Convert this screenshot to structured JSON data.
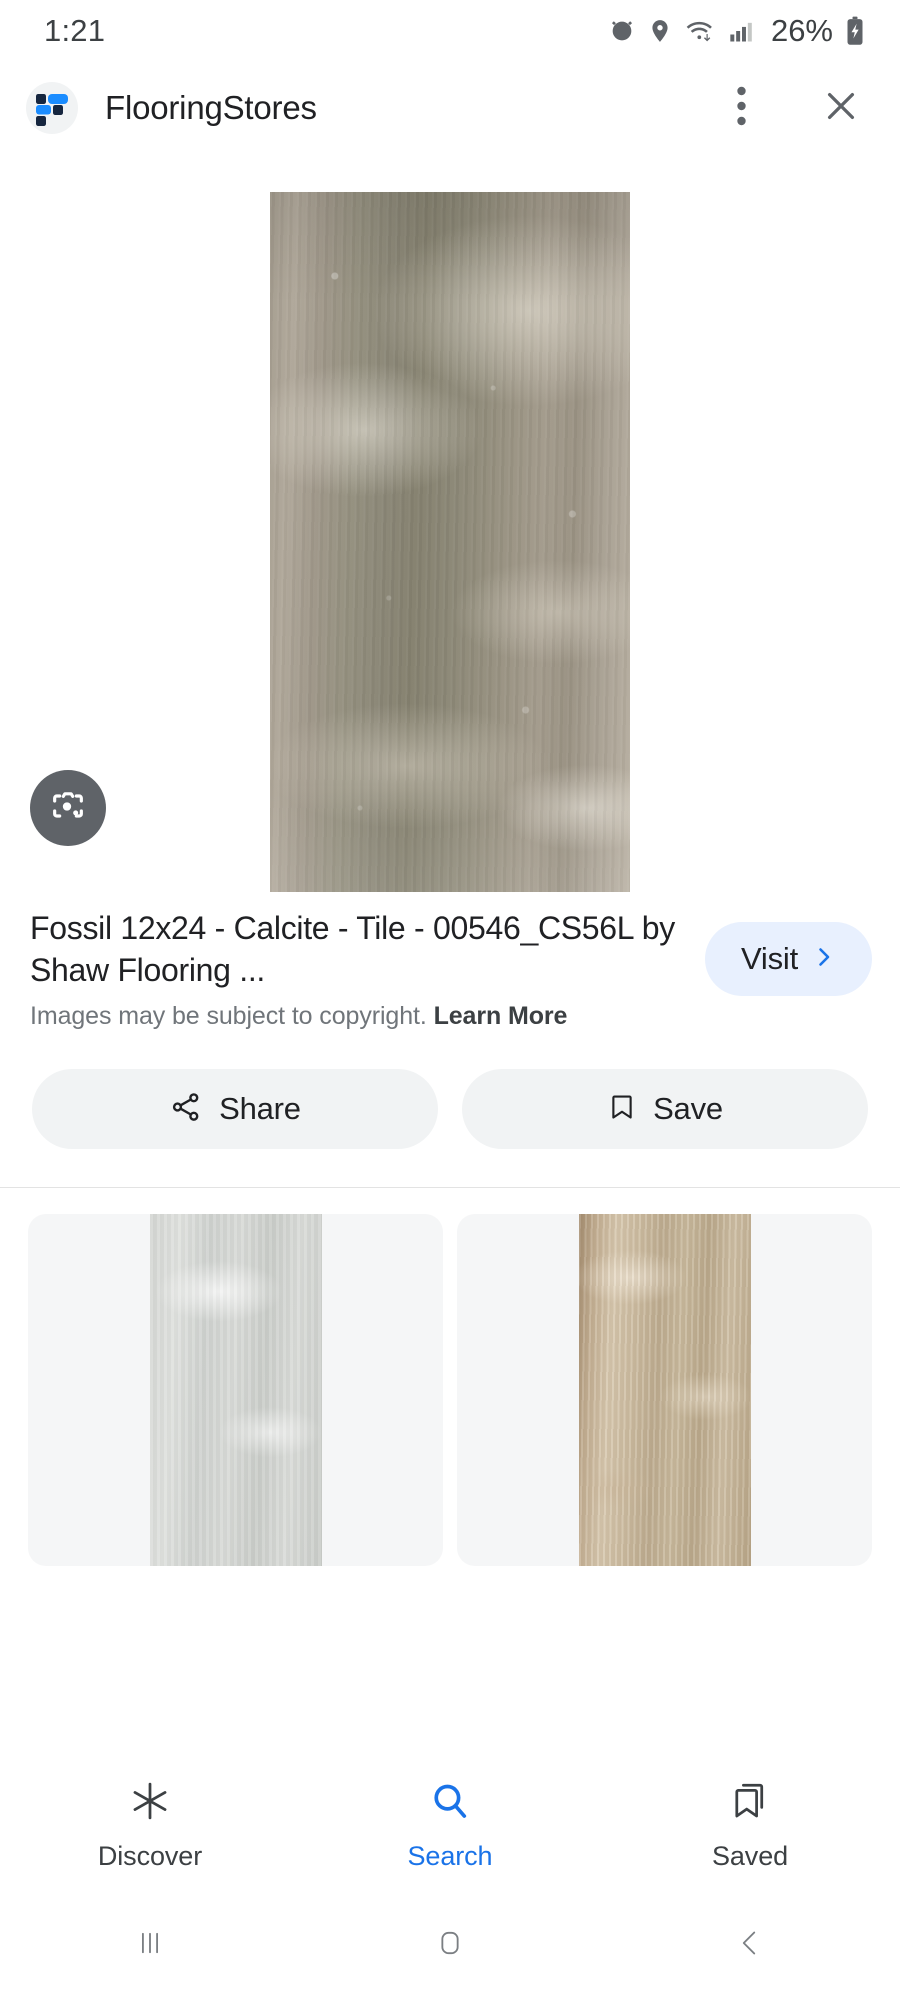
{
  "status_bar": {
    "time": "1:21",
    "battery_percent": "26%",
    "icons": [
      "alarm-icon",
      "location-pin-icon",
      "wifi-icon",
      "cellular-signal-icon",
      "battery-charging-icon"
    ]
  },
  "app_header": {
    "brand_name": "FlooringStores",
    "logo_icon": "flooringstores-grid-logo",
    "menu_icon": "kebab-menu-icon",
    "close_icon": "close-icon",
    "logo_colors": {
      "navy": "#16263f",
      "blue": "#1a8cff",
      "circle_bg": "#f1f3f4"
    }
  },
  "hero": {
    "lens_icon": "google-lens-icon",
    "lens_bg": "#5f6368",
    "alt": "Fossil 12x24 Calcite porcelain tile swatch, taupe grey stone texture"
  },
  "result": {
    "title": "Fossil 12x24 - Calcite - Tile - 00546_CS56L by Shaw Flooring ...",
    "copyright_text": "Images may be subject to copyright.",
    "learn_more": "Learn More",
    "visit_label": "Visit",
    "visit_chevron_icon": "chevron-right-icon",
    "visit_bg": "#e8f0fe",
    "accent": "#1a73e8"
  },
  "actions": [
    {
      "label": "Share",
      "icon": "share-nodes-icon"
    },
    {
      "label": "Save",
      "icon": "bookmark-icon"
    }
  ],
  "related_thumbnails": [
    {
      "name": "thumbnail-light-grey-tile",
      "tone": "light"
    },
    {
      "name": "thumbnail-tan-travertine-tile",
      "tone": "tan"
    }
  ],
  "bottom_nav": {
    "items": [
      {
        "label": "Discover",
        "icon": "sparkle-asterisk-icon",
        "active": false
      },
      {
        "label": "Search",
        "icon": "search-magnifier-icon",
        "active": true
      },
      {
        "label": "Saved",
        "icon": "bookmarks-stack-icon",
        "active": false
      }
    ],
    "active_color": "#1a73e8"
  },
  "system_nav": {
    "recents_icon": "recents-bars-icon",
    "home_icon": "home-square-icon",
    "back_icon": "back-chevron-icon"
  }
}
